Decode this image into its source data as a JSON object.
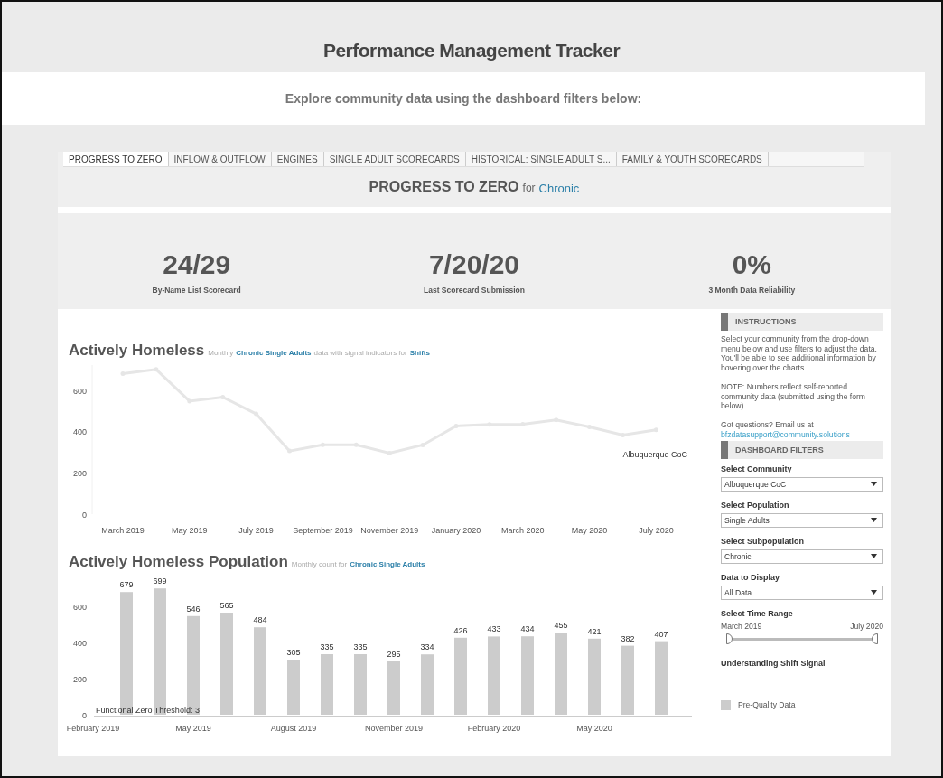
{
  "page_title": "Performance Management Tracker",
  "banner": "Explore community data using the dashboard filters below:",
  "tabs": [
    {
      "label": "PROGRESS TO ZERO",
      "selected": true
    },
    {
      "label": "INFLOW & OUTFLOW",
      "selected": false
    },
    {
      "label": "ENGINES",
      "selected": false
    },
    {
      "label": "SINGLE ADULT SCORECARDS",
      "selected": false
    },
    {
      "label": "HISTORICAL: SINGLE ADULT S...",
      "selected": false
    },
    {
      "label": "FAMILY & YOUTH SCORECARDS",
      "selected": false
    }
  ],
  "header": {
    "title": "PROGRESS TO ZERO",
    "connector": "for",
    "filter": "Chronic"
  },
  "kpis": [
    {
      "value": "24/29",
      "label": "By-Name List Scorecard"
    },
    {
      "value": "7/20/20",
      "label": "Last Scorecard Submission"
    },
    {
      "value": "0%",
      "label": "3 Month Data Reliability"
    }
  ],
  "line_panel": {
    "subtitle": [
      {
        "text": "Monthly",
        "highlight": false
      },
      {
        "text": "Chronic Single Adults",
        "highlight": true
      },
      {
        "text": "data with signal indicators for",
        "highlight": false
      },
      {
        "text": "Shifts",
        "highlight": true
      }
    ],
    "chart_data": {
      "type": "line",
      "title": "Actively Homeless",
      "categories": [
        "March 2019",
        null,
        "May 2019",
        null,
        "July 2019",
        null,
        "September 2019",
        null,
        "November 2019",
        null,
        "January 2020",
        null,
        "March 2020",
        null,
        "May 2020",
        null,
        "July 2020"
      ],
      "series": [
        {
          "name": "Albuquerque CoC",
          "color": "#e6e6e6",
          "values": [
            679,
            699,
            546,
            565,
            484,
            305,
            335,
            335,
            295,
            334,
            426,
            433,
            434,
            455,
            421,
            382,
            407
          ]
        }
      ],
      "ylim": [
        0,
        720
      ],
      "yticks": [
        0,
        200,
        400,
        600
      ]
    }
  },
  "bar_panel": {
    "subtitle": [
      {
        "text": "Monthly count for",
        "highlight": false
      },
      {
        "text": "Chronic Single Adults",
        "highlight": true
      }
    ],
    "chart_data": {
      "type": "bar",
      "title": "Actively Homeless Population",
      "categories": [
        "February 2019",
        null,
        null,
        "May 2019",
        null,
        null,
        "August 2019",
        null,
        null,
        "November 2019",
        null,
        null,
        "February 2020",
        null,
        null,
        "May 2020",
        null,
        null
      ],
      "values": [
        null,
        679,
        699,
        546,
        565,
        484,
        305,
        335,
        335,
        295,
        334,
        426,
        433,
        434,
        455,
        421,
        382,
        407
      ],
      "data_labels": true,
      "ylim": [
        0,
        720
      ],
      "yticks": [
        0,
        200,
        400,
        600
      ],
      "annotations": [
        "Functional Zero Threshold: 3"
      ]
    }
  },
  "sidebar": {
    "instructions_heading": "INSTRUCTIONS",
    "paragraphs": [
      "Select your community from the drop-down menu below and use filters to adjust the data.  You'll be able to see additional information by hovering over the charts.",
      "NOTE: Numbers reflect self-reported community data (submitted using the form below)."
    ],
    "contact": "Got questions?  Email us at",
    "email": "bfzdatasupport@community.solutions",
    "filters_heading": "DASHBOARD FILTERS",
    "filters": [
      {
        "label": "Select Community",
        "value": "Albuquerque CoC"
      },
      {
        "label": "Select Population",
        "value": "Single Adults"
      },
      {
        "label": "Select Subpopulation",
        "value": "Chronic"
      },
      {
        "label": "Data to Display",
        "value": "All Data"
      }
    ],
    "time_range": {
      "label": "Select Time Range",
      "start": "March 2019",
      "end": "July 2020",
      "level": 1
    },
    "shift_heading": "Understanding Shift Signal",
    "legend": "Pre-Quality Data"
  }
}
